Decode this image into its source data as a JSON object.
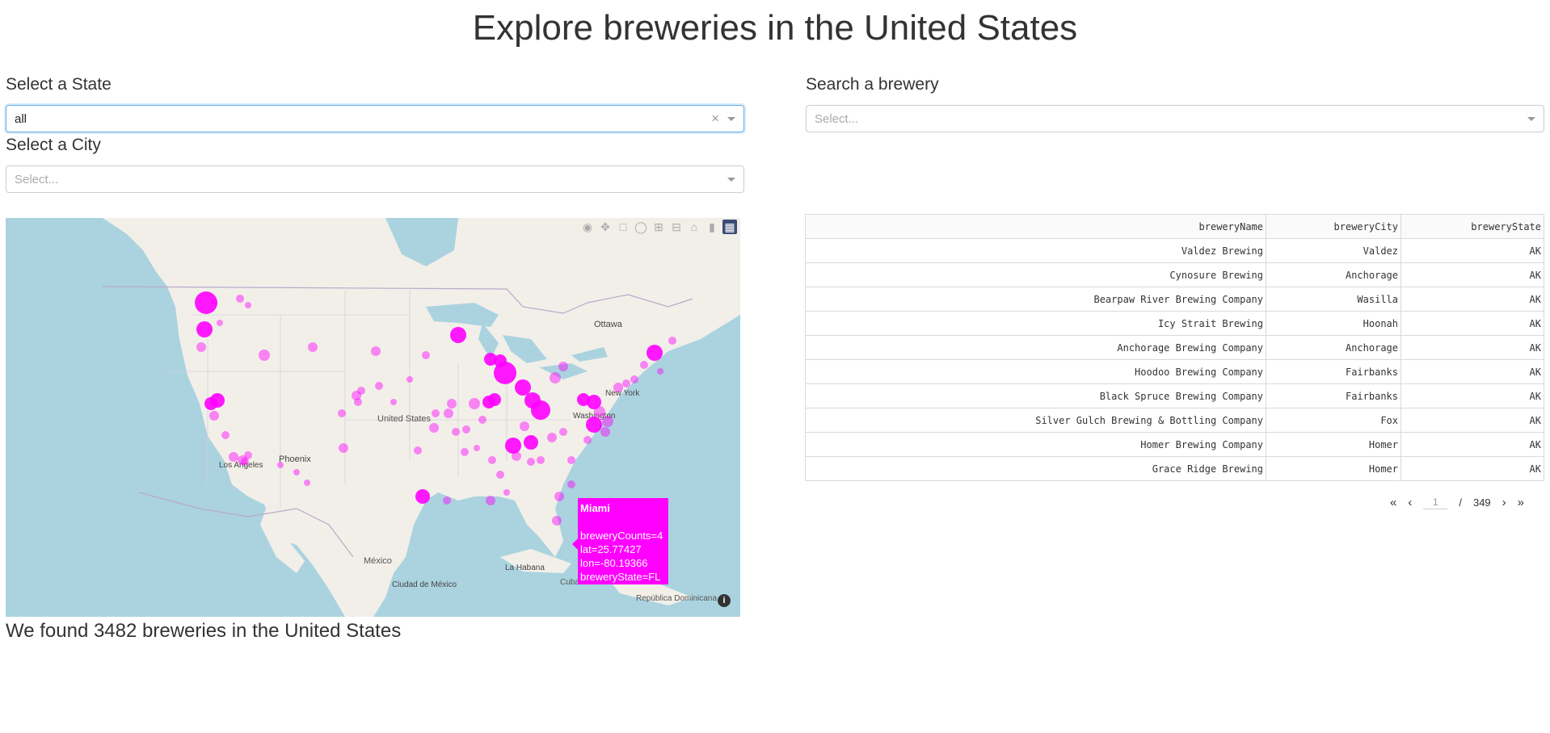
{
  "page_title": "Explore breweries in the United States",
  "state_select": {
    "label": "Select a State",
    "value": "all",
    "clear_glyph": "×"
  },
  "city_select": {
    "label": "Select a City",
    "placeholder": "Select..."
  },
  "brewery_search": {
    "label": "Search a brewery",
    "placeholder": "Select..."
  },
  "map": {
    "labels": [
      "Ottawa",
      "United States",
      "New York",
      "Washington",
      "Los Angeles",
      "Phoenix",
      "México",
      "Ciudad de México",
      "La Habana",
      "Cuba",
      "República Dominicana"
    ],
    "point_color": "#ff00ff",
    "modebar_icons": [
      "camera-icon",
      "pan-icon",
      "box-select-icon",
      "lasso-icon",
      "zoom-in-icon",
      "zoom-out-icon",
      "home-icon",
      "hover-icon",
      "plotly-logo-icon"
    ],
    "tooltip": {
      "title": "Miami",
      "lines": [
        "breweryCounts=4",
        "lat=25.77427",
        "lon=-80.19366",
        "breweryState=FL"
      ]
    }
  },
  "found_text": "We found 3482 breweries in the United States",
  "table": {
    "columns": [
      "breweryName",
      "breweryCity",
      "breweryState"
    ],
    "rows": [
      [
        "Valdez Brewing",
        "Valdez",
        "AK"
      ],
      [
        "Cynosure Brewing",
        "Anchorage",
        "AK"
      ],
      [
        "Bearpaw River Brewing Company",
        "Wasilla",
        "AK"
      ],
      [
        "Icy Strait Brewing",
        "Hoonah",
        "AK"
      ],
      [
        "Anchorage Brewing Company",
        "Anchorage",
        "AK"
      ],
      [
        "Hoodoo Brewing Company",
        "Fairbanks",
        "AK"
      ],
      [
        "Black Spruce Brewing Company",
        "Fairbanks",
        "AK"
      ],
      [
        "Silver Gulch Brewing & Bottling Company",
        "Fox",
        "AK"
      ],
      [
        "Homer Brewing Company",
        "Homer",
        "AK"
      ],
      [
        "Grace Ridge Brewing",
        "Homer",
        "AK"
      ]
    ]
  },
  "pagination": {
    "first": "«",
    "prev": "‹",
    "current": "1",
    "separator": "/",
    "total": "349",
    "next": "›",
    "last": "»"
  }
}
